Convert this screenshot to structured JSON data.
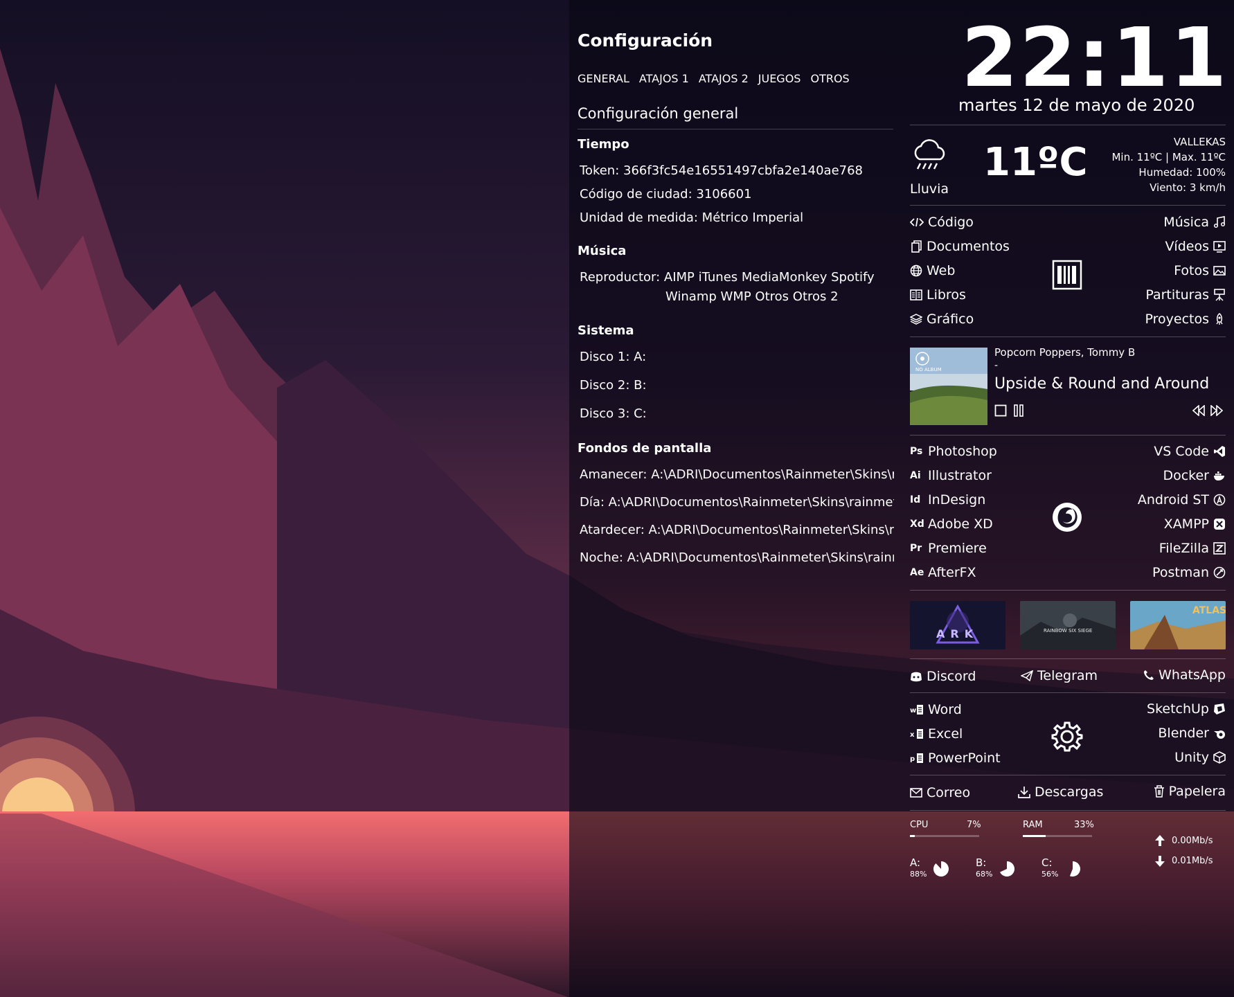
{
  "config": {
    "title": "Configuración",
    "tabs": [
      "GENERAL",
      "ATAJOS 1",
      "ATAJOS 2",
      "JUEGOS",
      "OTROS"
    ],
    "section_title": "Configuración general",
    "tiempo": {
      "heading": "Tiempo",
      "token": "Token: 366f3fc54e16551497cbfa2e140ae768",
      "city_code": "Código de ciudad: 3106601",
      "unit": "Unidad de medida: Métrico Imperial"
    },
    "musica": {
      "heading": "Música",
      "player_line1": "Reproductor: AIMP iTunes MediaMonkey Spotify",
      "player_line2": "Winamp WMP Otros Otros 2"
    },
    "sistema": {
      "heading": "Sistema",
      "disk1": "Disco 1: A:",
      "disk2": "Disco 2: B:",
      "disk3": "Disco 3: C:"
    },
    "fondos": {
      "heading": "Fondos de pantalla",
      "amanecer": "Amanecer: A:\\ADRI\\Documentos\\Rainmeter\\Skins\\rainmeter",
      "dia": "Día: A:\\ADRI\\Documentos\\Rainmeter\\Skins\\rainmeter",
      "atardecer": "Atardecer: A:\\ADRI\\Documentos\\Rainmeter\\Skins\\rainmeter",
      "noche": "Noche: A:\\ADRI\\Documentos\\Rainmeter\\Skins\\rainmeter"
    }
  },
  "clock": {
    "time": "22:11",
    "date": "martes 12 de mayo de 2020"
  },
  "weather": {
    "temp": "11ºC",
    "condition": "Lluvia",
    "location": "VALLEKAS",
    "minmax": "Min. 11ºC | Max. 11ºC",
    "humidity": "Humedad: 100%",
    "wind": "Viento: 3 km/h"
  },
  "folders_left": [
    "Código",
    "Documentos",
    "Web",
    "Libros",
    "Gráfico"
  ],
  "folders_right": [
    "Música",
    "Vídeos",
    "Fotos",
    "Partituras",
    "Proyectos"
  ],
  "music": {
    "artist": "Popcorn Poppers, Tommy B",
    "album_sep": "-",
    "track": "Upside & Round and Around",
    "cover_text": "NO ALBUM"
  },
  "apps_left": [
    {
      "tag": "Ps",
      "label": "Photoshop"
    },
    {
      "tag": "Ai",
      "label": "Illustrator"
    },
    {
      "tag": "Id",
      "label": "InDesign"
    },
    {
      "tag": "Xd",
      "label": "Adobe XD"
    },
    {
      "tag": "Pr",
      "label": "Premiere"
    },
    {
      "tag": "Ae",
      "label": "AfterFX"
    }
  ],
  "apps_right": [
    "VS Code",
    "Docker",
    "Android ST",
    "XAMPP",
    "FileZilla",
    "Postman"
  ],
  "games": [
    "ARK",
    "RAINBOW SIX SIEGE",
    "ATLAS"
  ],
  "social": [
    "Discord",
    "Telegram",
    "WhatsApp"
  ],
  "office_left": [
    "Word",
    "Excel",
    "PowerPoint"
  ],
  "office_right": [
    "SketchUp",
    "Blender",
    "Unity"
  ],
  "bottom_links": [
    "Correo",
    "Descargas",
    "Papelera"
  ],
  "stats": {
    "cpu_label": "CPU",
    "cpu_value": "7%",
    "cpu_fraction": 0.07,
    "ram_label": "RAM",
    "ram_value": "33%",
    "ram_fraction": 0.33,
    "up": "0.00Mb/s",
    "down": "0.01Mb/s",
    "disks": [
      {
        "label": "A:",
        "value": "88%",
        "fraction": 0.88
      },
      {
        "label": "B:",
        "value": "68%",
        "fraction": 0.68
      },
      {
        "label": "C:",
        "value": "56%",
        "fraction": 0.56
      }
    ]
  },
  "colors": {
    "accent": "#ffffff",
    "sunset": "#f06a6d"
  }
}
